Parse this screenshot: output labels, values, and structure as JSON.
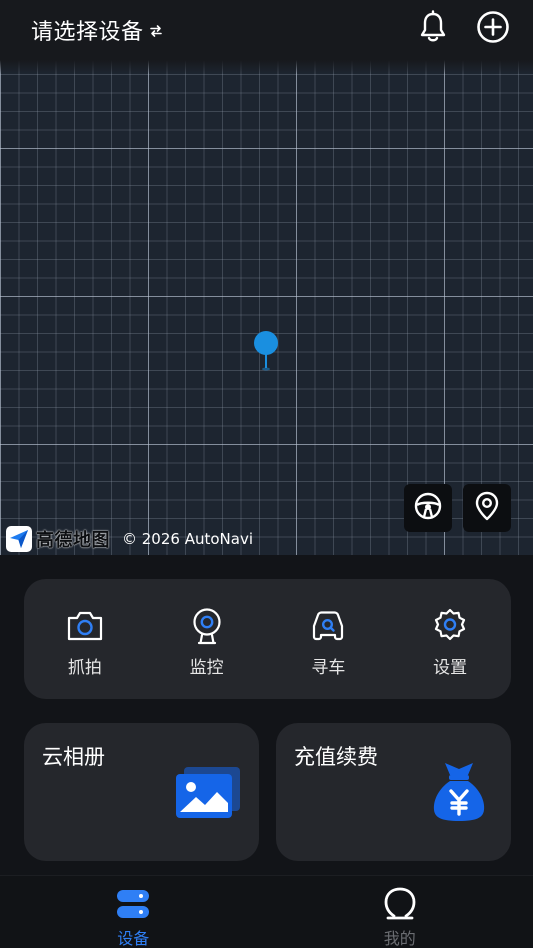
{
  "header": {
    "title": "请选择设备",
    "switch_icon": "swap-arrows-icon",
    "bell_icon": "bell-icon",
    "add_icon": "plus-circle-icon"
  },
  "map": {
    "brand_name": "高德地图",
    "copyright": "© 2026 AutoNavi",
    "pin_color": "#1a8fe0",
    "steering_button_icon": "steering-wheel-icon",
    "locate_button_icon": "location-pin-icon"
  },
  "actions": [
    {
      "label": "抓拍",
      "icon": "camera-icon"
    },
    {
      "label": "监控",
      "icon": "webcam-icon"
    },
    {
      "label": "寻车",
      "icon": "car-search-icon"
    },
    {
      "label": "设置",
      "icon": "gear-icon"
    }
  ],
  "cards": {
    "album": {
      "title": "云相册",
      "icon": "photo-album-icon"
    },
    "recharge": {
      "title": "充值续费",
      "icon": "money-bag-icon"
    }
  },
  "tabbar": {
    "tabs": [
      {
        "label": "设备",
        "icon": "device-icon",
        "active": true
      },
      {
        "label": "我的",
        "icon": "profile-icon",
        "active": false
      }
    ]
  },
  "colors": {
    "accent": "#2f7ff5",
    "icon_blue": "#1565e8",
    "card_bg": "#25272c",
    "page_bg": "#121418"
  }
}
